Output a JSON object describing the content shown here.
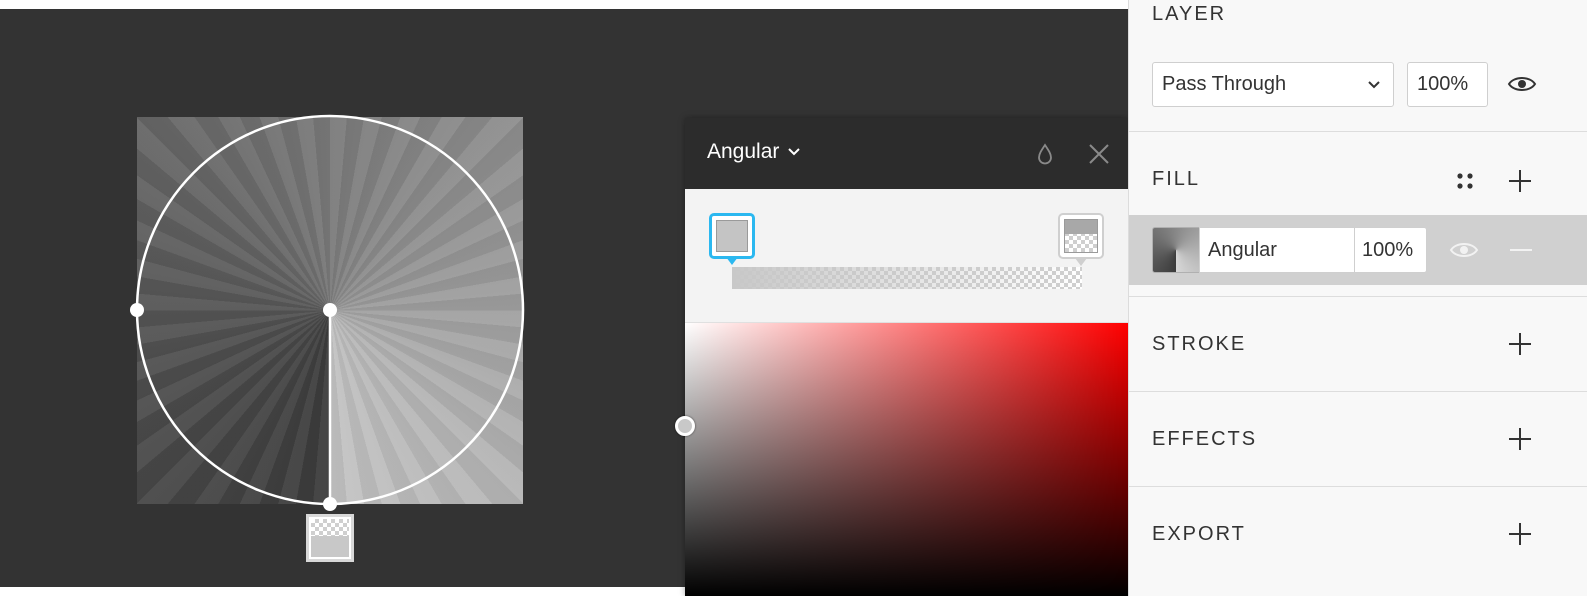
{
  "picker": {
    "type_label": "Angular",
    "header_icons": [
      "drop-icon",
      "close-icon"
    ],
    "accent": "#2bb8f0"
  },
  "panel": {
    "layer": {
      "title": "LAYER",
      "blend_mode": "Pass Through",
      "opacity": "100%"
    },
    "fill": {
      "title": "FILL",
      "type": "Angular",
      "opacity": "100%"
    },
    "stroke": {
      "title": "STROKE"
    },
    "effects": {
      "title": "EFFECTS"
    },
    "export": {
      "title": "EXPORT"
    }
  },
  "colors": {
    "canvas_bg": "#333333",
    "panel_bg": "#f8f8f8",
    "selected_row": "#d0d0d0",
    "hue": "#ff0000"
  }
}
